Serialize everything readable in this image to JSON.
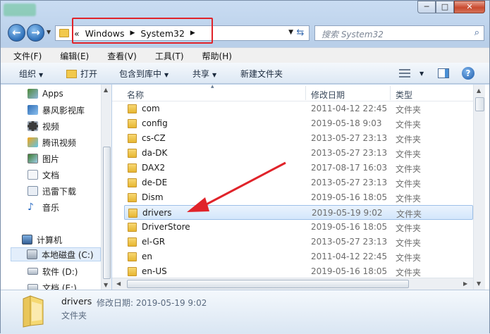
{
  "window": {
    "controls": {
      "minimize": "─",
      "maximize": "□",
      "close": "✕"
    }
  },
  "address": {
    "prefix": "«",
    "crumbs": [
      "Windows",
      "System32"
    ],
    "search_placeholder": "搜索 System32"
  },
  "menu": [
    "文件(F)",
    "编辑(E)",
    "查看(V)",
    "工具(T)",
    "帮助(H)"
  ],
  "toolbar": {
    "organize": "组织",
    "open": "打开",
    "include": "包含到库中",
    "share": "共享",
    "new_folder": "新建文件夹",
    "help": "?"
  },
  "navpane": {
    "items": [
      {
        "label": "Apps",
        "icon": "apps-icon"
      },
      {
        "label": "暴风影视库",
        "icon": "media-library-icon"
      },
      {
        "label": "视频",
        "icon": "video-icon"
      },
      {
        "label": "腾讯视频",
        "icon": "tencent-video-icon"
      },
      {
        "label": "图片",
        "icon": "pictures-icon"
      },
      {
        "label": "文档",
        "icon": "documents-icon"
      },
      {
        "label": "迅雷下载",
        "icon": "xunlei-download-icon"
      },
      {
        "label": "音乐",
        "icon": "music-icon"
      }
    ],
    "computer": "计算机",
    "drives": [
      {
        "label": "本地磁盘 (C:)",
        "selected": true
      },
      {
        "label": "软件 (D:)",
        "selected": false
      },
      {
        "label": "文档 (E:)",
        "selected": false
      }
    ]
  },
  "columns": {
    "name": "名称",
    "date": "修改日期",
    "type": "类型"
  },
  "files": [
    {
      "name": "com",
      "date": "2011-04-12 22:45",
      "type": "文件夹"
    },
    {
      "name": "config",
      "date": "2019-05-18 9:03",
      "type": "文件夹"
    },
    {
      "name": "cs-CZ",
      "date": "2013-05-27 23:13",
      "type": "文件夹"
    },
    {
      "name": "da-DK",
      "date": "2013-05-27 23:13",
      "type": "文件夹"
    },
    {
      "name": "DAX2",
      "date": "2017-08-17 16:03",
      "type": "文件夹"
    },
    {
      "name": "de-DE",
      "date": "2013-05-27 23:13",
      "type": "文件夹"
    },
    {
      "name": "Dism",
      "date": "2019-05-16 18:05",
      "type": "文件夹"
    },
    {
      "name": "drivers",
      "date": "2019-05-19 9:02",
      "type": "文件夹",
      "selected": true
    },
    {
      "name": "DriverStore",
      "date": "2019-05-16 18:05",
      "type": "文件夹"
    },
    {
      "name": "el-GR",
      "date": "2013-05-27 23:13",
      "type": "文件夹"
    },
    {
      "name": "en",
      "date": "2011-04-12 22:45",
      "type": "文件夹"
    },
    {
      "name": "en-US",
      "date": "2019-05-16 18:05",
      "type": "文件夹"
    }
  ],
  "details": {
    "name": "drivers",
    "meta": "修改日期: 2019-05-19 9:02",
    "type": "文件夹"
  },
  "colors": {
    "annotation": "#e0232a",
    "selection": "#d3e6fb",
    "folder": "#f2c94c"
  }
}
